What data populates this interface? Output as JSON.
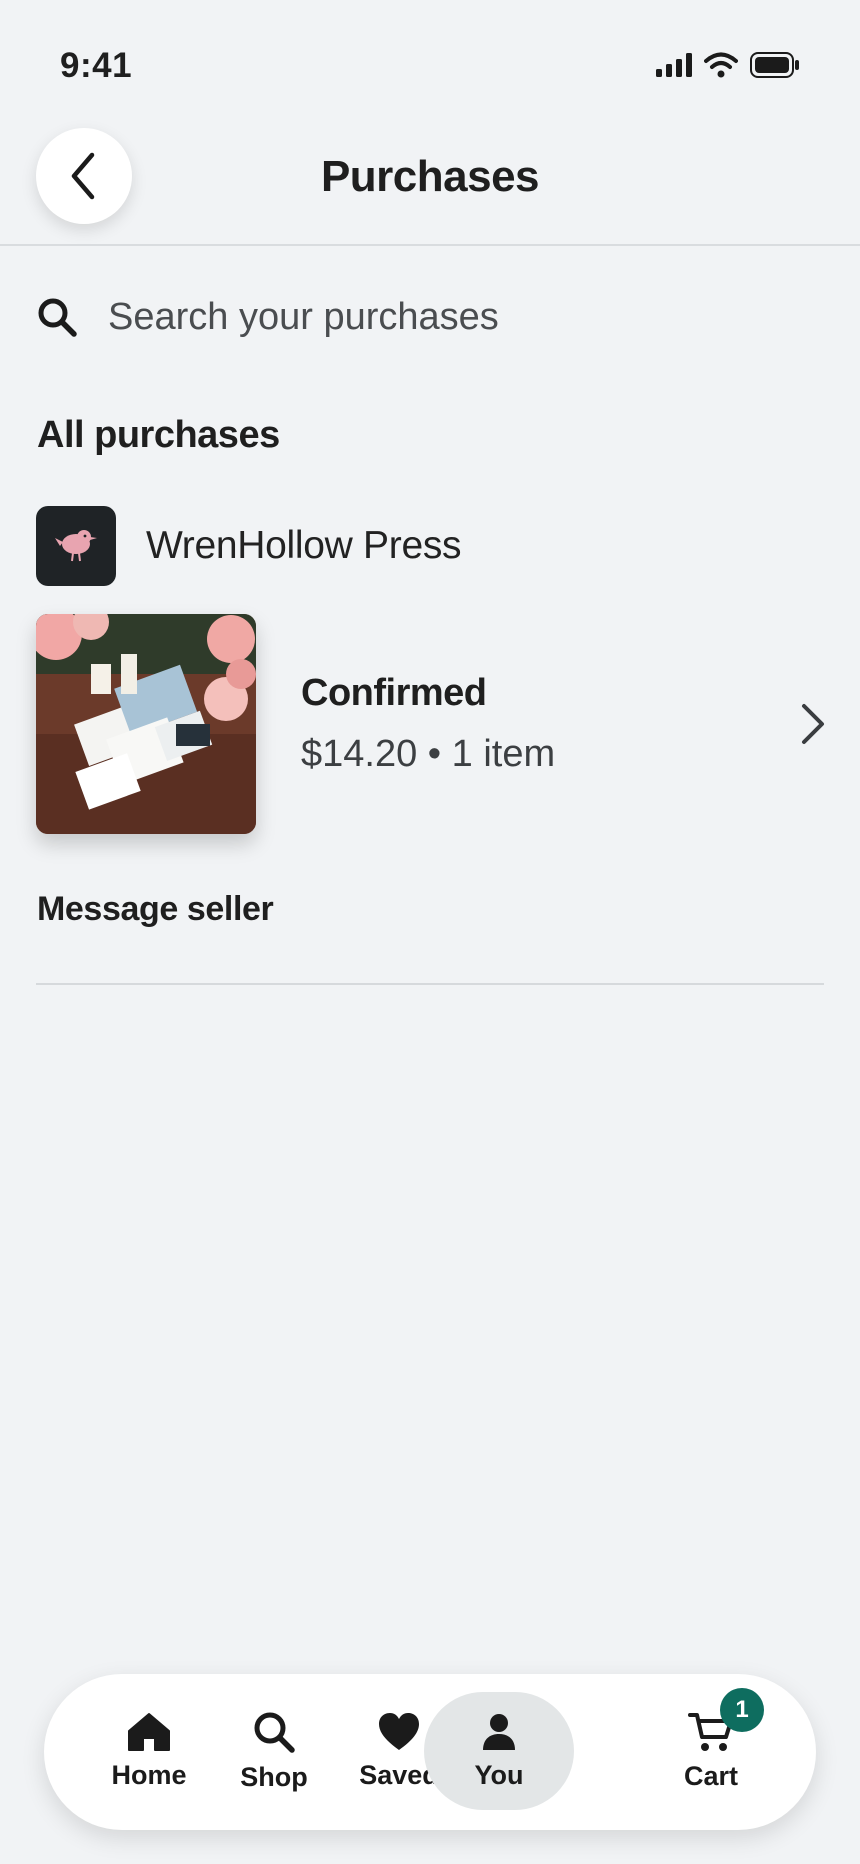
{
  "status_bar": {
    "time": "9:41"
  },
  "header": {
    "title": "Purchases"
  },
  "search": {
    "placeholder": "Search your purchases"
  },
  "section": {
    "heading": "All purchases"
  },
  "shop": {
    "name": "WrenHollow Press"
  },
  "order": {
    "status": "Confirmed",
    "summary": "$14.20 • 1 item"
  },
  "actions": {
    "message_seller": "Message seller"
  },
  "tabbar": {
    "tabs": [
      {
        "label": "Home",
        "icon": "home-icon"
      },
      {
        "label": "Shop",
        "icon": "search-icon"
      },
      {
        "label": "Saved",
        "icon": "heart-icon"
      },
      {
        "label": "You",
        "icon": "person-icon",
        "active": true
      },
      {
        "label": "Cart",
        "icon": "cart-icon",
        "badge": "1"
      }
    ]
  },
  "colors": {
    "background": "#f1f3f5",
    "badge": "#0e6d5f",
    "active_tab": "#e3e6e7"
  }
}
